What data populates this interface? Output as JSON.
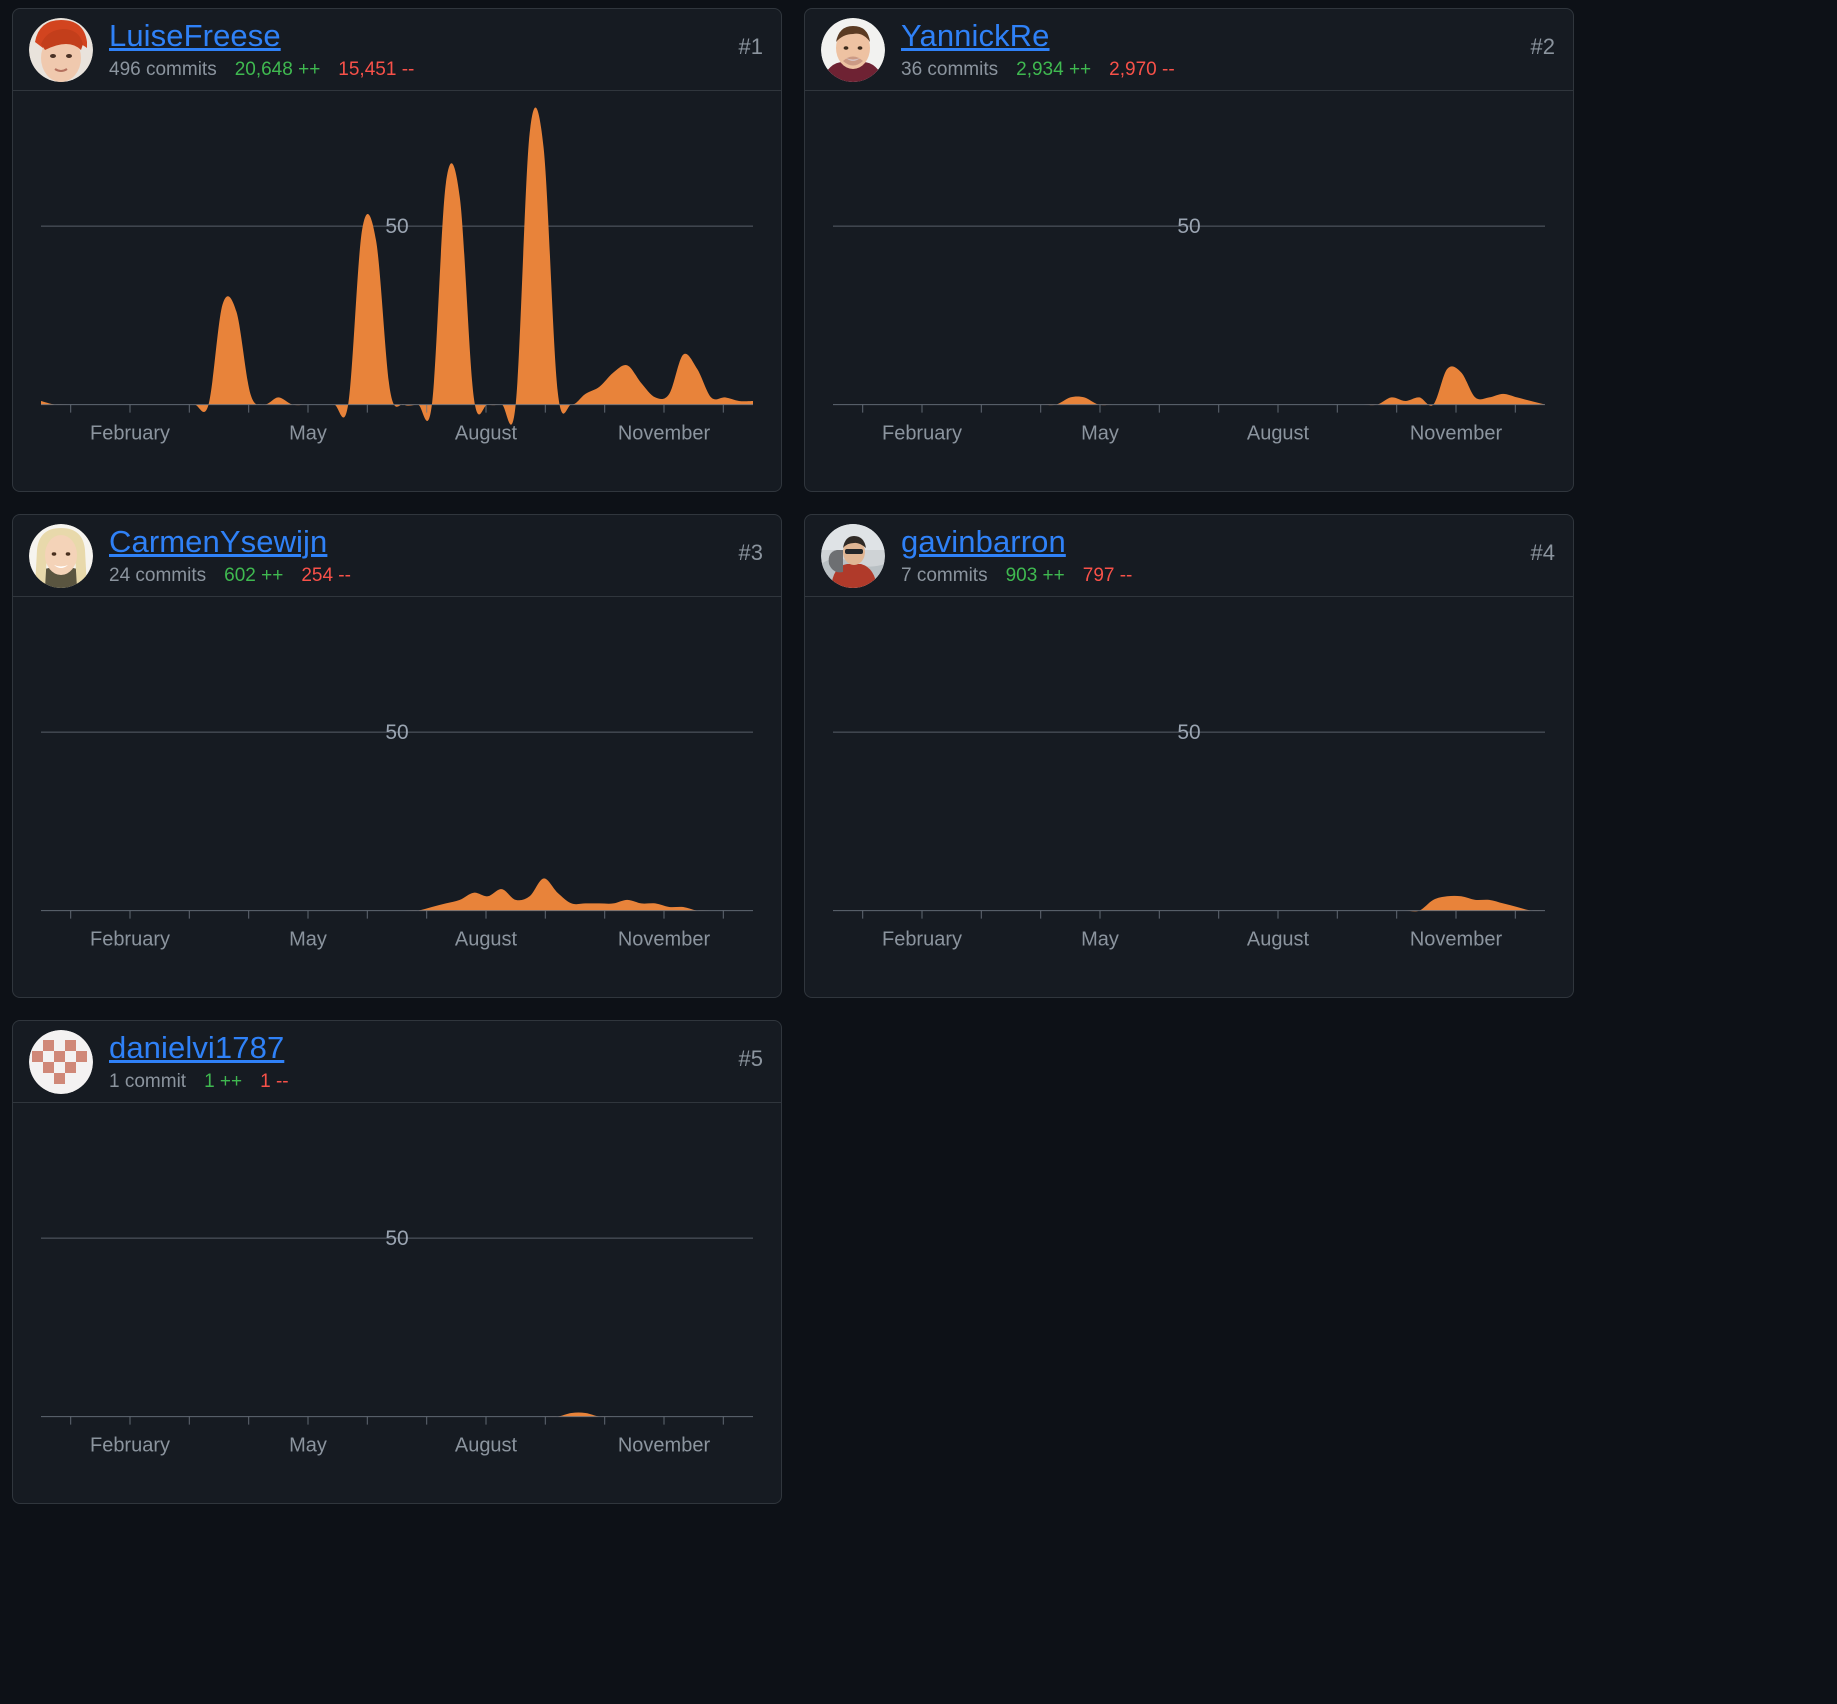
{
  "theme": {
    "page_bg": "#0d1117",
    "card_bg": "#161b22",
    "border": "#30363d",
    "username_color": "#2f81f7",
    "muted_text": "#8b949e",
    "additions_color": "#3fb950",
    "deletions_color": "#f85149",
    "series_color": "#e8833a",
    "gridline_color": "#6e7681"
  },
  "chart_data": [
    {
      "type": "area",
      "title": "LuiseFreese",
      "xlabel": "",
      "ylabel": "",
      "ylim": [
        0,
        80
      ],
      "gridlines": [
        50
      ],
      "gridline_labels": [
        "50"
      ],
      "grid": true,
      "legend": "none",
      "tick_labels": [
        "February",
        "May",
        "August",
        "November"
      ],
      "x": [
        1,
        2,
        3,
        4,
        5,
        6,
        7,
        8,
        9,
        10,
        11,
        12,
        13,
        14,
        15,
        16,
        17,
        18,
        19,
        20,
        21,
        22,
        23,
        24,
        25,
        26,
        27,
        28,
        29,
        30,
        31,
        32,
        33,
        34,
        35,
        36,
        37,
        38,
        39,
        40,
        41,
        42,
        43,
        44,
        45,
        46,
        47,
        48,
        49,
        50,
        51,
        52
      ],
      "values": [
        1,
        0,
        0,
        0,
        0,
        0,
        0,
        0,
        0,
        0,
        0,
        0,
        0,
        28,
        26,
        3,
        0,
        2,
        0,
        0,
        0,
        0,
        0,
        49,
        46,
        4,
        0,
        0,
        0,
        62,
        58,
        2,
        0,
        0,
        0,
        76,
        72,
        4,
        0,
        3,
        5,
        9,
        11,
        6,
        2,
        3,
        14,
        10,
        2,
        2,
        1,
        1
      ]
    },
    {
      "type": "area",
      "title": "YannickRe",
      "xlabel": "",
      "ylabel": "",
      "ylim": [
        0,
        80
      ],
      "gridlines": [
        50
      ],
      "gridline_labels": [
        "50"
      ],
      "grid": true,
      "legend": "none",
      "tick_labels": [
        "February",
        "May",
        "August",
        "November"
      ],
      "x": [
        1,
        2,
        3,
        4,
        5,
        6,
        7,
        8,
        9,
        10,
        11,
        12,
        13,
        14,
        15,
        16,
        17,
        18,
        19,
        20,
        21,
        22,
        23,
        24,
        25,
        26,
        27,
        28,
        29,
        30,
        31,
        32,
        33,
        34,
        35,
        36,
        37,
        38,
        39,
        40,
        41,
        42,
        43,
        44,
        45,
        46,
        47,
        48,
        49,
        50,
        51,
        52
      ],
      "values": [
        0,
        0,
        0,
        0,
        0,
        0,
        0,
        0,
        0,
        0,
        0,
        0,
        0,
        0,
        0,
        0,
        0,
        2,
        2,
        0,
        0,
        0,
        0,
        0,
        0,
        0,
        0,
        0,
        0,
        0,
        0,
        0,
        0,
        0,
        0,
        0,
        0,
        0,
        0,
        0,
        2,
        1,
        2,
        0,
        10,
        9,
        2,
        2,
        3,
        2,
        1,
        0
      ]
    },
    {
      "type": "area",
      "title": "CarmenYsewijn",
      "xlabel": "",
      "ylabel": "",
      "ylim": [
        0,
        80
      ],
      "gridlines": [
        50
      ],
      "gridline_labels": [
        "50"
      ],
      "grid": true,
      "legend": "none",
      "tick_labels": [
        "February",
        "May",
        "August",
        "November"
      ],
      "x": [
        1,
        2,
        3,
        4,
        5,
        6,
        7,
        8,
        9,
        10,
        11,
        12,
        13,
        14,
        15,
        16,
        17,
        18,
        19,
        20,
        21,
        22,
        23,
        24,
        25,
        26,
        27,
        28,
        29,
        30,
        31,
        32,
        33,
        34,
        35,
        36,
        37,
        38,
        39,
        40,
        41,
        42,
        43,
        44,
        45,
        46,
        47,
        48,
        49,
        50,
        51,
        52
      ],
      "values": [
        0,
        0,
        0,
        0,
        0,
        0,
        0,
        0,
        0,
        0,
        0,
        0,
        0,
        0,
        0,
        0,
        0,
        0,
        0,
        0,
        0,
        0,
        0,
        0,
        0,
        0,
        0,
        0,
        1,
        2,
        3,
        5,
        4,
        6,
        3,
        4,
        9,
        5,
        2,
        2,
        2,
        2,
        3,
        2,
        2,
        1,
        1,
        0,
        0,
        0,
        0,
        0
      ]
    },
    {
      "type": "area",
      "title": "gavinbarron",
      "xlabel": "",
      "ylabel": "",
      "ylim": [
        0,
        80
      ],
      "gridlines": [
        50
      ],
      "gridline_labels": [
        "50"
      ],
      "grid": true,
      "legend": "none",
      "tick_labels": [
        "February",
        "May",
        "August",
        "November"
      ],
      "x": [
        1,
        2,
        3,
        4,
        5,
        6,
        7,
        8,
        9,
        10,
        11,
        12,
        13,
        14,
        15,
        16,
        17,
        18,
        19,
        20,
        21,
        22,
        23,
        24,
        25,
        26,
        27,
        28,
        29,
        30,
        31,
        32,
        33,
        34,
        35,
        36,
        37,
        38,
        39,
        40,
        41,
        42,
        43,
        44,
        45,
        46,
        47,
        48,
        49,
        50,
        51,
        52
      ],
      "values": [
        0,
        0,
        0,
        0,
        0,
        0,
        0,
        0,
        0,
        0,
        0,
        0,
        0,
        0,
        0,
        0,
        0,
        0,
        0,
        0,
        0,
        0,
        0,
        0,
        0,
        0,
        0,
        0,
        0,
        0,
        0,
        0,
        0,
        0,
        0,
        0,
        0,
        0,
        0,
        0,
        0,
        0,
        0,
        3,
        4,
        4,
        3,
        3,
        2,
        1,
        0,
        0
      ]
    },
    {
      "type": "area",
      "title": "danielvi1787",
      "xlabel": "",
      "ylabel": "",
      "ylim": [
        0,
        80
      ],
      "gridlines": [
        50
      ],
      "gridline_labels": [
        "50"
      ],
      "grid": true,
      "legend": "none",
      "tick_labels": [
        "February",
        "May",
        "August",
        "November"
      ],
      "x": [
        1,
        2,
        3,
        4,
        5,
        6,
        7,
        8,
        9,
        10,
        11,
        12,
        13,
        14,
        15,
        16,
        17,
        18,
        19,
        20,
        21,
        22,
        23,
        24,
        25,
        26,
        27,
        28,
        29,
        30,
        31,
        32,
        33,
        34,
        35,
        36,
        37,
        38,
        39,
        40,
        41,
        42,
        43,
        44,
        45,
        46,
        47,
        48,
        49,
        50,
        51,
        52
      ],
      "values": [
        0,
        0,
        0,
        0,
        0,
        0,
        0,
        0,
        0,
        0,
        0,
        0,
        0,
        0,
        0,
        0,
        0,
        0,
        0,
        0,
        0,
        0,
        0,
        0,
        0,
        0,
        0,
        0,
        0,
        0,
        0,
        0,
        0,
        0,
        0,
        0,
        0,
        0,
        1,
        1,
        0,
        0,
        0,
        0,
        0,
        0,
        0,
        0,
        0,
        0,
        0,
        0
      ]
    }
  ],
  "contributors": [
    {
      "rank": "#1",
      "username": "LuiseFreese",
      "commits": "496 commits",
      "additions": "20,648 ++",
      "deletions": "15,451 --",
      "avatar": "avatar-luisefreese"
    },
    {
      "rank": "#2",
      "username": "YannickRe",
      "commits": "36 commits",
      "additions": "2,934 ++",
      "deletions": "2,970 --",
      "avatar": "avatar-yannickre"
    },
    {
      "rank": "#3",
      "username": "CarmenYsewijn",
      "commits": "24 commits",
      "additions": "602 ++",
      "deletions": "254 --",
      "avatar": "avatar-carmenysewijn"
    },
    {
      "rank": "#4",
      "username": "gavinbarron",
      "commits": "7 commits",
      "additions": "903 ++",
      "deletions": "797 --",
      "avatar": "avatar-gavinbarron"
    },
    {
      "rank": "#5",
      "username": "danielvi1787",
      "commits": "1 commit",
      "additions": "1 ++",
      "deletions": "1 --",
      "avatar": "avatar-danielvi1787"
    }
  ]
}
